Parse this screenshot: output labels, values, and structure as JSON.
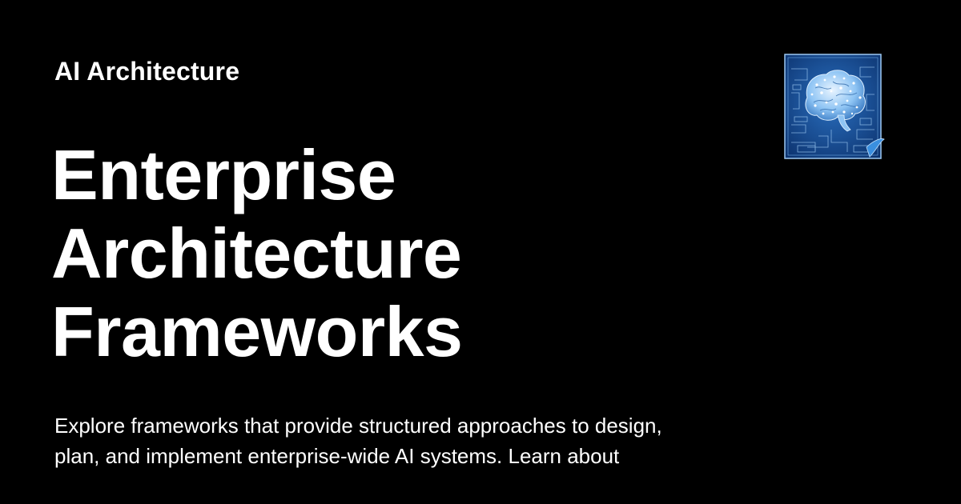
{
  "site": {
    "name": "AI Architecture"
  },
  "article": {
    "title_lines": [
      "Enterprise",
      "Architecture",
      "Frameworks"
    ],
    "description_lines": [
      "Explore frameworks that provide structured approaches to design,",
      "plan, and implement enterprise-wide AI systems. Learn about"
    ]
  },
  "logo": {
    "icon": "brain-blueprint-icon"
  },
  "colors": {
    "background": "#000000",
    "text": "#ffffff",
    "logo_blue": "#1f5fa8",
    "logo_light": "#cfe6ff"
  }
}
